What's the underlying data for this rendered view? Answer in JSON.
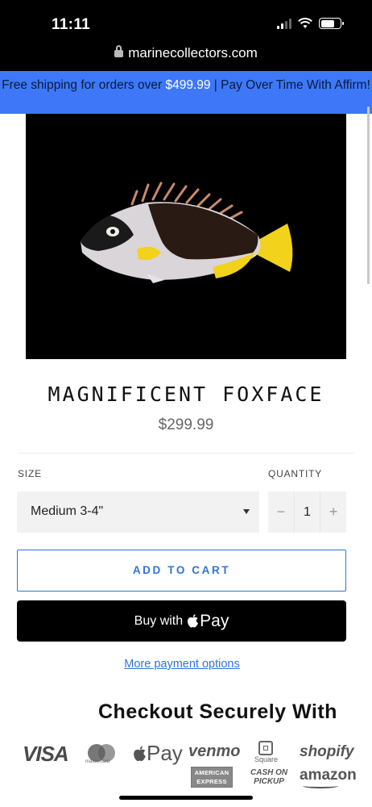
{
  "status_bar": {
    "time": "11:11",
    "url": "marinecollectors.com"
  },
  "promo": {
    "text_before": "Free shipping for orders over ",
    "highlight": "$499.99",
    "text_after": " | Pay Over Time With Affirm!",
    "background": "#3e78f8"
  },
  "product": {
    "image_icon": "fish-photo",
    "title": "MAGNIFICENT FOXFACE",
    "price": "$299.99"
  },
  "options": {
    "size_label": "SIZE",
    "size_value": "Medium 3-4\"",
    "quantity_label": "QUANTITY",
    "quantity_value": "1",
    "decrement": "−",
    "increment": "+"
  },
  "actions": {
    "add_to_cart": "ADD TO CART",
    "buy_with": "Buy with",
    "pay": "Pay",
    "more_payment": "More payment options",
    "accent": "#2f74d8"
  },
  "checkout": {
    "title": "Checkout Securely With",
    "logos": {
      "visa": "VISA",
      "mastercard": "mastercard",
      "apple_pay": "Pay",
      "venmo": "venmo",
      "square": "Square",
      "shopify": "shopify",
      "amex_line1": "AMERICAN",
      "amex_line2": "EXPRESS",
      "cod_line1": "CASH ON",
      "cod_line2": "PICKUP",
      "amazon": "amazon"
    }
  }
}
